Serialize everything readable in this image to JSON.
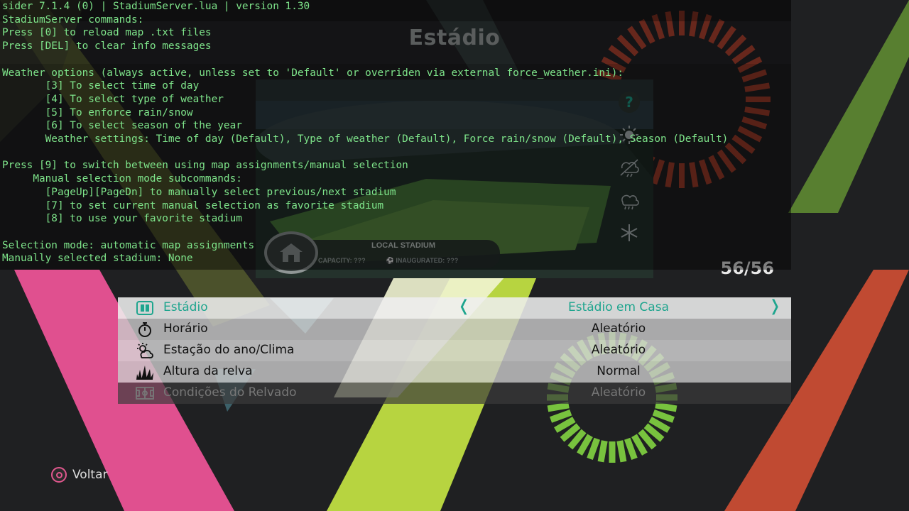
{
  "screen": {
    "title": "Estádio",
    "counter": "56/56",
    "back_label": "Voltar"
  },
  "stadium_preview": {
    "name": "LOCAL STADIUM",
    "capacity": "CAPACITY: ???",
    "inaugurated": "INAUGURATED: ???",
    "side_icons": [
      "help-icon",
      "sun-icon",
      "partly-rainy-icon",
      "rain-icon",
      "snowflake-icon"
    ]
  },
  "menu": [
    {
      "label": "Estádio",
      "value": "Estádio em Casa",
      "icon": "stadium-icon",
      "state": "selected"
    },
    {
      "label": "Horário",
      "value": "Aleatório",
      "icon": "stopwatch-icon",
      "state": "normal"
    },
    {
      "label": "Estação do ano/Clima",
      "value": "Aleatório",
      "icon": "weather-icon",
      "state": "normal"
    },
    {
      "label": "Altura da relva",
      "value": "Normal",
      "icon": "grass-icon",
      "state": "normal"
    },
    {
      "label": "Condições do Relvado",
      "value": "Aleatório",
      "icon": "pitch-icon",
      "state": "disabled"
    }
  ],
  "arrows": {
    "left": "❬",
    "right": "❭"
  },
  "console_lines": [
    "sider 7.1.4 (0) | StadiumServer.lua | version 1.30",
    "StadiumServer commands:",
    "Press [0] to reload map .txt files",
    "Press [DEL] to clear info messages",
    "",
    "Weather options (always active, unless set to 'Default' or overriden via external force_weather.ini):",
    "       [3] To select time of day",
    "       [4] To select type of weather",
    "       [5] To enforce rain/snow",
    "       [6] To select season of the year",
    "       Weather settings: Time of day (Default), Type of weather (Default), Force rain/snow (Default), Season (Default)",
    "",
    "Press [9] to switch between using map assignments/manual selection",
    "     Manual selection mode subcommands:",
    "       [PageUp][PageDn] to manually select previous/next stadium",
    "       [7] to set current manual selection as favorite stadium",
    "       [8] to use your favorite stadium",
    "",
    "Selection mode: automatic map assignments",
    "Manually selected stadium: None"
  ],
  "colors": {
    "accent": "#1ea58e",
    "console_text": "#7ee48a",
    "circle_button": "#e0578e"
  }
}
